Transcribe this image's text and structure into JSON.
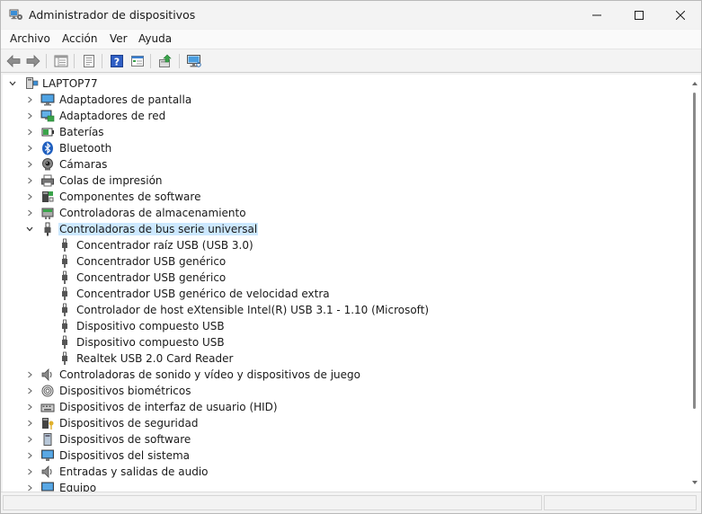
{
  "window": {
    "title": "Administrador de dispositivos",
    "controls": {
      "minimize": "minimize-icon",
      "maximize": "maximize-icon",
      "close": "close-icon"
    }
  },
  "menu": [
    {
      "label": "Archivo"
    },
    {
      "label": "Acción"
    },
    {
      "label": "Ver"
    },
    {
      "label": "Ayuda"
    }
  ],
  "toolbar": [
    "back-arrow-icon",
    "forward-arrow-icon",
    "properties-list-icon",
    "properties-page-icon",
    "help-icon",
    "view-details-icon",
    "update-driver-icon",
    "scan-hardware-icon"
  ],
  "tree": {
    "root": {
      "label": "LAPTOP77",
      "icon": "computer-icon",
      "expanded": true
    },
    "categories": [
      {
        "label": "Adaptadores de pantalla",
        "icon": "monitor-icon"
      },
      {
        "label": "Adaptadores de red",
        "icon": "network-icon"
      },
      {
        "label": "Baterías",
        "icon": "battery-icon"
      },
      {
        "label": "Bluetooth",
        "icon": "bluetooth-icon"
      },
      {
        "label": "Cámaras",
        "icon": "camera-icon"
      },
      {
        "label": "Colas de impresión",
        "icon": "printer-icon"
      },
      {
        "label": "Componentes de software",
        "icon": "software-component-icon"
      },
      {
        "label": "Controladoras de almacenamiento",
        "icon": "storage-controller-icon"
      },
      {
        "label": "Controladoras de bus serie universal",
        "icon": "usb-icon",
        "expanded": true,
        "selected": true,
        "children": [
          {
            "label": "Concentrador raíz USB (USB 3.0)"
          },
          {
            "label": "Concentrador USB genérico"
          },
          {
            "label": "Concentrador USB genérico"
          },
          {
            "label": "Concentrador USB genérico de velocidad extra"
          },
          {
            "label": "Controlador de host eXtensible Intel(R) USB 3.1 - 1.10 (Microsoft)"
          },
          {
            "label": "Dispositivo compuesto USB"
          },
          {
            "label": "Dispositivo compuesto USB"
          },
          {
            "label": "Realtek USB 2.0 Card Reader"
          }
        ]
      },
      {
        "label": "Controladoras de sonido y vídeo y dispositivos de juego",
        "icon": "speaker-icon"
      },
      {
        "label": "Dispositivos biométricos",
        "icon": "fingerprint-icon"
      },
      {
        "label": "Dispositivos de interfaz de usuario (HID)",
        "icon": "keyboard-icon"
      },
      {
        "label": "Dispositivos de seguridad",
        "icon": "security-key-icon"
      },
      {
        "label": "Dispositivos de software",
        "icon": "software-device-icon"
      },
      {
        "label": "Dispositivos del sistema",
        "icon": "system-device-icon"
      },
      {
        "label": "Entradas y salidas de audio",
        "icon": "audio-io-icon"
      },
      {
        "label": "Equipo",
        "icon": "computer-small-icon"
      }
    ]
  },
  "colors": {
    "selection": "#cce8ff",
    "background": "#f3f3f3",
    "tree_bg": "#ffffff"
  }
}
